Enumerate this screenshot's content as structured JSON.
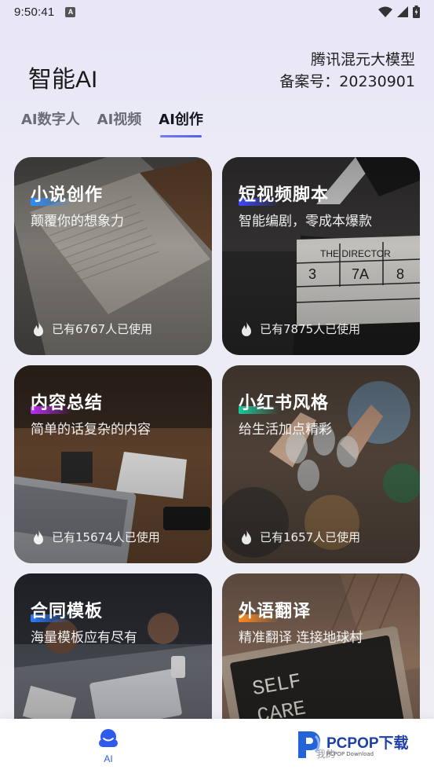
{
  "status_bar": {
    "time": "9:50:41",
    "notification_badge": "A"
  },
  "header": {
    "app_title": "智能AI",
    "model_name": "腾讯混元大模型",
    "record_number": "备案号：20230901"
  },
  "tabs": [
    {
      "label": "AI数字人",
      "active": false
    },
    {
      "label": "AI视频",
      "active": false
    },
    {
      "label": "AI创作",
      "active": true
    }
  ],
  "cards": [
    {
      "title": "小说创作",
      "subtitle": "颠覆你的想象力",
      "usage": "已有6767人已使用",
      "accent": "#2b8cff",
      "icon": "fire-icon"
    },
    {
      "title": "短视频脚本",
      "subtitle": "智能编剧，零成本爆款",
      "usage": "已有7875人已使用",
      "accent": "#3b48ff",
      "icon": "fire-icon"
    },
    {
      "title": "内容总结",
      "subtitle": "简单的话复杂的内容",
      "usage": "已有15674人已使用",
      "accent": "#c12cff",
      "icon": "fire-icon"
    },
    {
      "title": "小红书风格",
      "subtitle": "给生活加点精彩",
      "usage": "已有1657人已使用",
      "accent": "#18c99a",
      "icon": "fire-icon"
    },
    {
      "title": "合同模板",
      "subtitle": "海量模板应有尽有",
      "usage": "",
      "accent": "#2f7bff",
      "icon": "fire-icon"
    },
    {
      "title": "外语翻译",
      "subtitle": "精准翻译 连接地球村",
      "usage": "",
      "accent": "#ff8a1f",
      "icon": "fire-icon"
    }
  ],
  "bottom_nav": {
    "ai_label": "AI",
    "mine_label": "我的"
  },
  "watermark": {
    "brand": "PCPOP下载",
    "sub": "PCPOP Download"
  }
}
